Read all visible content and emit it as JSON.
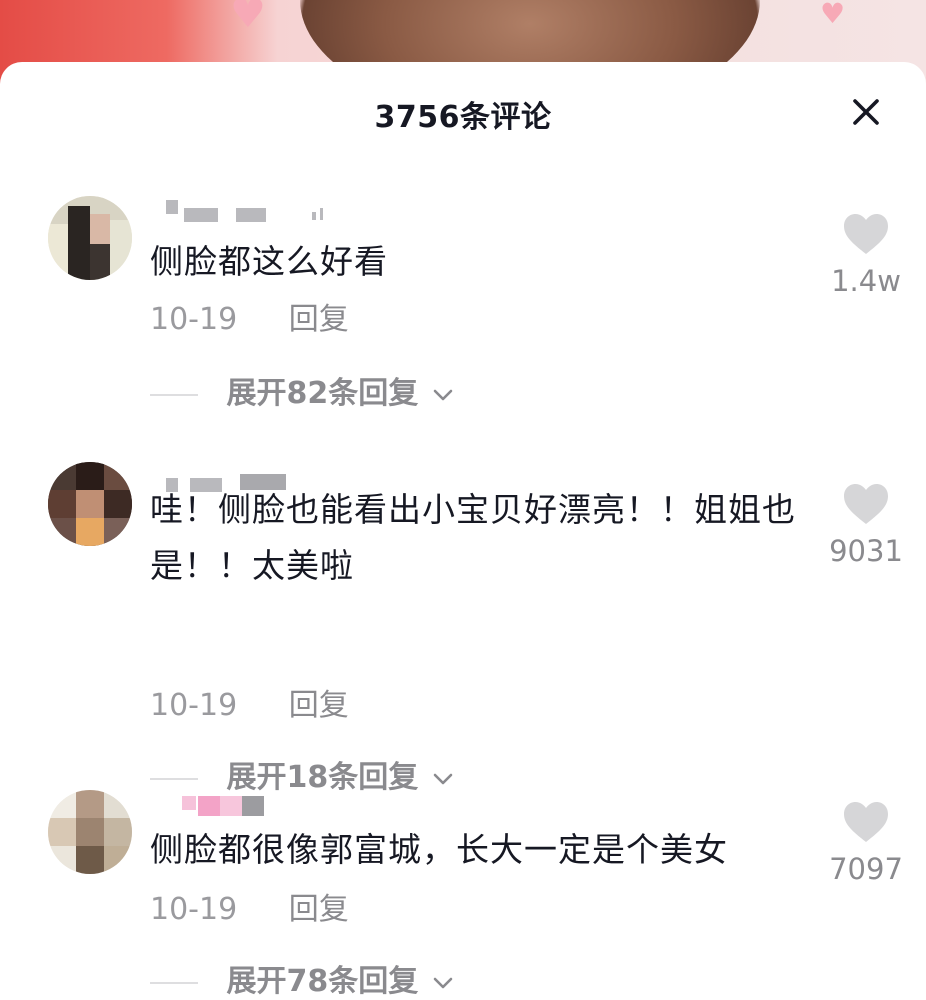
{
  "header": {
    "title": "3756条评论"
  },
  "comments": [
    {
      "text": "侧脸都这么好看",
      "date": "10-19",
      "reply_label": "回复",
      "expand_label": "展开82条回复",
      "likes": "1.4w"
    },
    {
      "text": "哇！侧脸也能看出小宝贝好漂亮！！姐姐也是！！太美啦",
      "date": "10-19",
      "reply_label": "回复",
      "expand_label": "展开18条回复",
      "likes": "9031"
    },
    {
      "text": "侧脸都很像郭富城，长大一定是个美女",
      "date": "10-19",
      "reply_label": "回复",
      "expand_label": "展开78条回复",
      "likes": "7097"
    }
  ],
  "colors": {
    "text_primary": "#161823",
    "text_secondary": "#8a8a8e",
    "heart_gray": "#d6d6d8"
  },
  "icons": {
    "close": "close-icon",
    "like": "heart-icon",
    "expand": "chevron-down-icon"
  }
}
